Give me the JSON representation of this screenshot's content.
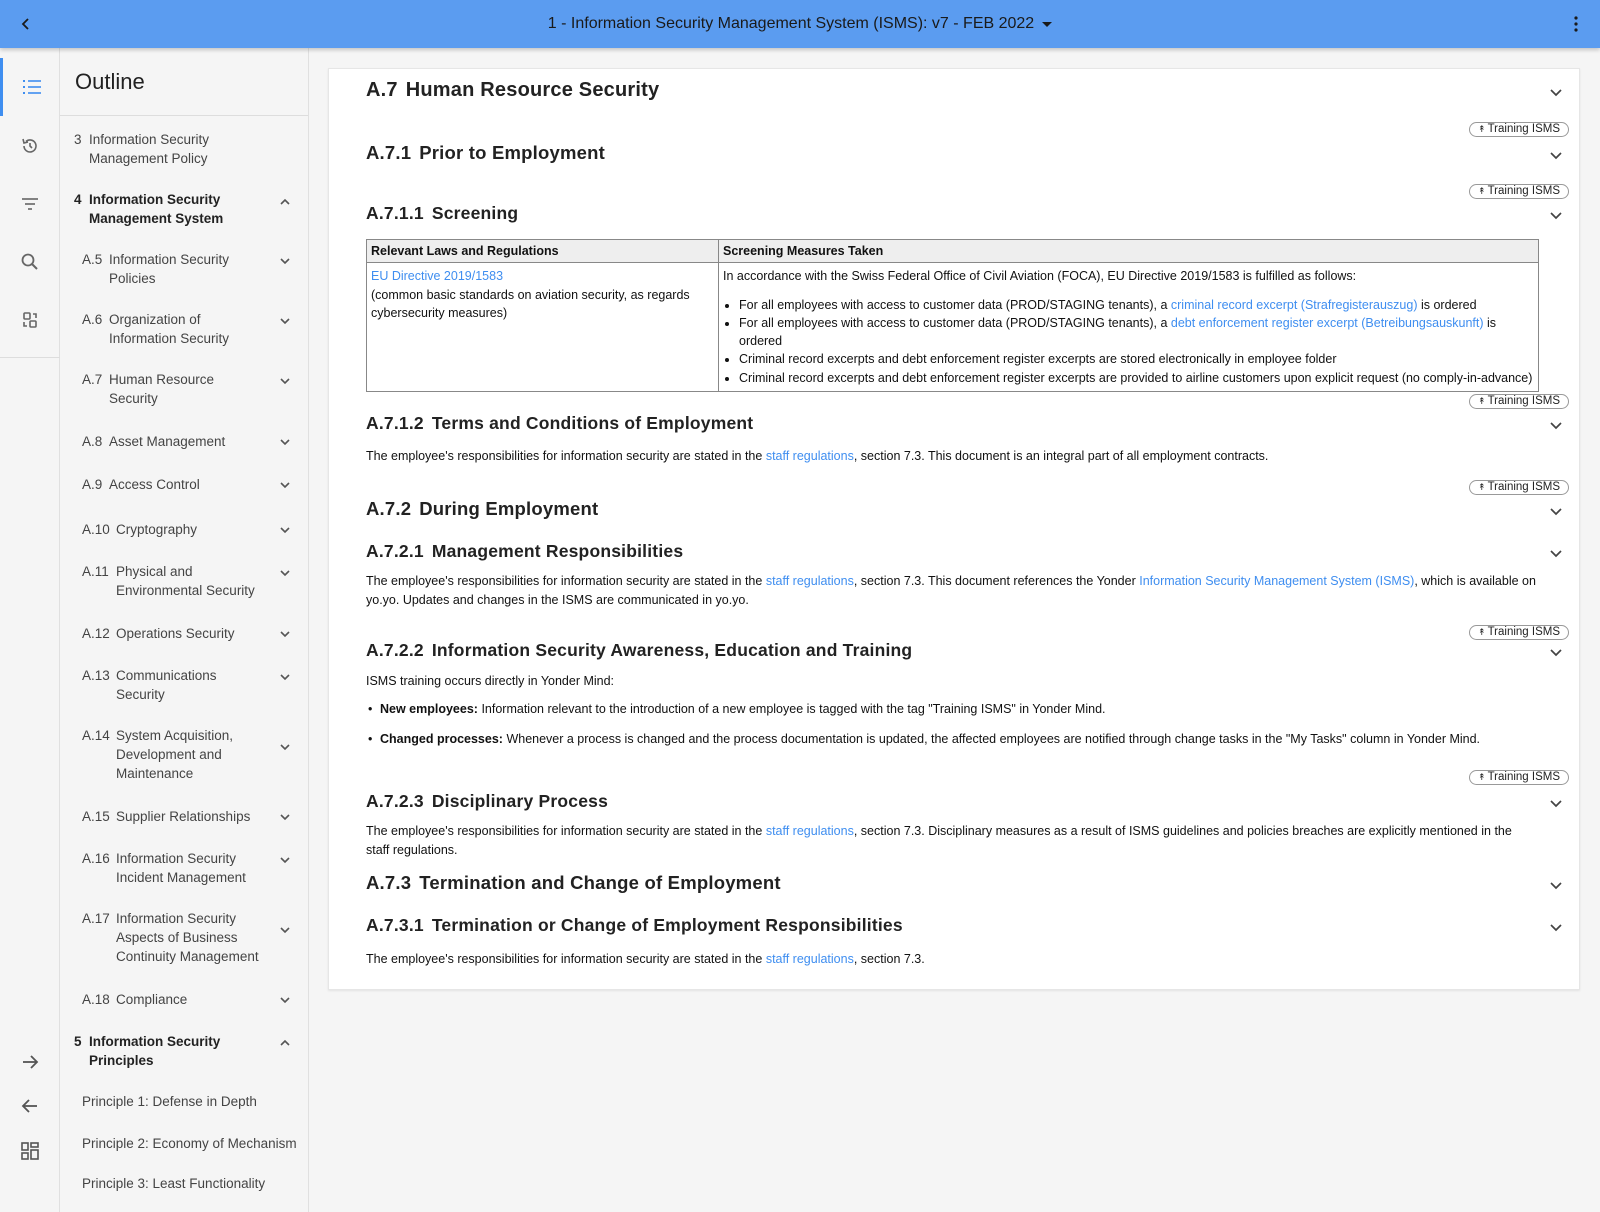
{
  "header": {
    "title": "1 - Information Security Management System (ISMS): v7 - FEB 2022"
  },
  "outline": {
    "title": "Outline",
    "items": [
      {
        "num": "3",
        "label": "Information Security Management Policy"
      },
      {
        "num": "4",
        "label": "Information Security Management System"
      },
      {
        "num": "A.5",
        "label": "Information Security Policies"
      },
      {
        "num": "A.6",
        "label": "Organization of Information Security"
      },
      {
        "num": "A.7",
        "label": "Human Resource Security"
      },
      {
        "num": "A.8",
        "label": "Asset Management"
      },
      {
        "num": "A.9",
        "label": "Access Control"
      },
      {
        "num": "A.10",
        "label": "Cryptography"
      },
      {
        "num": "A.11",
        "label": "Physical and Environmental Security"
      },
      {
        "num": "A.12",
        "label": "Operations Security"
      },
      {
        "num": "A.13",
        "label": "Communications Security"
      },
      {
        "num": "A.14",
        "label": "System Acquisition, Development and Maintenance"
      },
      {
        "num": "A.15",
        "label": "Supplier Relationships"
      },
      {
        "num": "A.16",
        "label": "Information Security Incident Management"
      },
      {
        "num": "A.17",
        "label": "Information Security Aspects of Business Continuity Management"
      },
      {
        "num": "A.18",
        "label": "Compliance"
      },
      {
        "num": "5",
        "label": "Information Security Principles"
      },
      {
        "num": "",
        "label": "Principle 1: Defense in Depth"
      },
      {
        "num": "",
        "label": "Principle 2: Economy of Mechanism"
      },
      {
        "num": "",
        "label": "Principle 3: Least Functionality"
      }
    ]
  },
  "badge_label": "Training ISMS",
  "doc": {
    "a7": {
      "num": "A.7",
      "title": "Human Resource Security"
    },
    "a71": {
      "num": "A.7.1",
      "title": "Prior to Employment"
    },
    "a711": {
      "num": "A.7.1.1",
      "title": "Screening"
    },
    "table": {
      "headers": [
        "Relevant Laws and Regulations",
        "Screening Measures Taken"
      ],
      "law_link": "EU Directive 2019/1583",
      "law_desc": "(common basic standards on aviation security, as regards cybersecurity measures)",
      "intro": "In accordance with the Swiss Federal Office of Civil Aviation (FOCA), EU Directive 2019/1583 is fulfilled as follows:",
      "b1_pre": "For all employees with access to customer data (PROD/STAGING tenants), a ",
      "b1_link": "criminal record excerpt (Strafregisterauszug)",
      "b1_post": " is ordered",
      "b2_pre": "For all employees with access to customer data (PROD/STAGING tenants), a ",
      "b2_link": "debt enforcement register excerpt (Betreibungsauskunft)",
      "b2_post": " is ordered",
      "b3": "Criminal record excerpts and debt enforcement register excerpts are stored electronically in employee folder",
      "b4": "Criminal record excerpts and debt enforcement register excerpts are provided to airline customers upon explicit request (no comply-in-advance)"
    },
    "a712": {
      "num": "A.7.1.2",
      "title": "Terms and Conditions of Employment",
      "pre": "The employee's responsibilities for information security are stated in the ",
      "link": "staff regulations",
      "post": ", section 7.3. This document is an integral part of all employment contracts."
    },
    "a72": {
      "num": "A.7.2",
      "title": "During Employment"
    },
    "a721": {
      "num": "A.7.2.1",
      "title": "Management Responsibilities",
      "pre": "The employee's responsibilities for information security are stated in the ",
      "link": "staff regulations",
      "mid": ", section 7.3. This document references the Yonder ",
      "link2": "Information Security Management System (ISMS)",
      "post": ", which is available on yo.yo. Updates and changes in the ISMS are communicated in yo.yo."
    },
    "a722": {
      "num": "A.7.2.2",
      "title": "Information Security Awareness, Education and Training",
      "intro": "ISMS training occurs directly in Yonder Mind:",
      "b1_label": "New employees:",
      "b1_text": " Information relevant to the introduction of a new employee is tagged with the tag \"Training ISMS\" in Yonder Mind.",
      "b2_label": "Changed processes:",
      "b2_text": " Whenever a process is changed and the process documentation is updated, the affected employees are notified through change tasks in the \"My Tasks\" column in Yonder Mind."
    },
    "a723": {
      "num": "A.7.2.3",
      "title": "Disciplinary Process",
      "pre": "The employee's responsibilities for information security are stated in the ",
      "link": "staff regulations",
      "post": ", section 7.3. Disciplinary measures as a result of ISMS guidelines and policies breaches are explicitly mentioned in the staff regulations."
    },
    "a73": {
      "num": "A.7.3",
      "title": "Termination and Change of Employment"
    },
    "a731": {
      "num": "A.7.3.1",
      "title": "Termination or Change of Employment Responsibilities",
      "pre": "The employee's responsibilities for information security are stated in the ",
      "link": "staff regulations",
      "post": ", section 7.3."
    }
  },
  "colors": {
    "header": "#5b9cf0",
    "link": "#3f8ef0",
    "accent": "#3f8ef0"
  }
}
